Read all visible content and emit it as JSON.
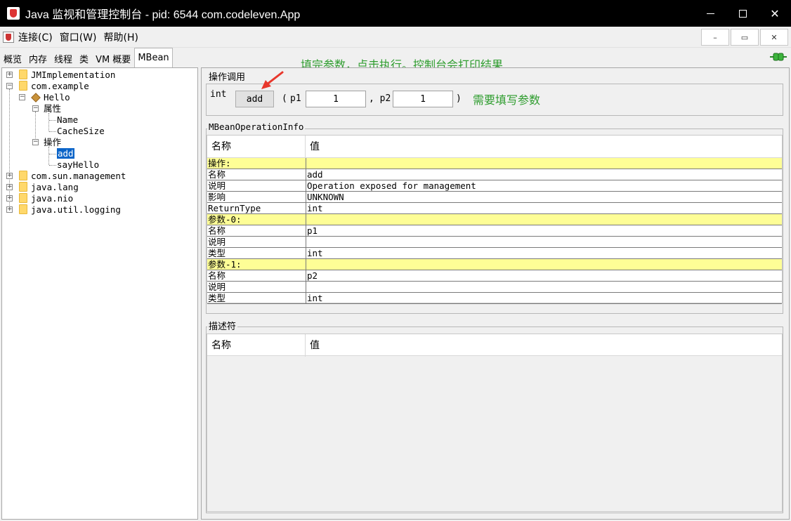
{
  "window": {
    "title": "Java 监视和管理控制台 - pid: 6544 com.codeleven.App",
    "min_label": "",
    "close_label": "✕"
  },
  "menubar": {
    "items": [
      "连接(C)",
      "窗口(W)",
      "帮助(H)"
    ],
    "mdi_min": "–",
    "mdi_restore": "▭",
    "mdi_close": "✕"
  },
  "tabs": [
    "概览",
    "内存",
    "线程",
    "类",
    "VM 概要",
    "MBean"
  ],
  "active_tab": "MBean",
  "annotations": {
    "top": "填完参数，点击执行。控制台会打印结果",
    "right": "需要填写参数"
  },
  "tree": {
    "nodes": [
      "JMImplementation",
      "com.example",
      "Hello",
      "属性",
      "Name",
      "CacheSize",
      "操作",
      "add",
      "sayHello",
      "com.sun.management",
      "java.lang",
      "java.nio",
      "java.util.logging"
    ],
    "selected": "add"
  },
  "operation": {
    "group_title": "操作调用",
    "return_type": "int",
    "button_label": "add",
    "open_paren": "(",
    "p1_label": "p1",
    "p1_value": "1",
    "comma_p2": ", p2",
    "p2_value": "1",
    "close_paren": ")"
  },
  "info": {
    "group_title": "MBeanOperationInfo",
    "headers": [
      "名称",
      "值"
    ],
    "rows": [
      {
        "name": "操作:",
        "value": "",
        "highlight": true
      },
      {
        "name": "名称",
        "value": "add",
        "highlight": false
      },
      {
        "name": "说明",
        "value": "Operation exposed for management",
        "highlight": false
      },
      {
        "name": "影响",
        "value": "UNKNOWN",
        "highlight": false
      },
      {
        "name": "ReturnType",
        "value": "int",
        "highlight": false
      },
      {
        "name": "参数-0:",
        "value": "",
        "highlight": true
      },
      {
        "name": "名称",
        "value": "p1",
        "highlight": false
      },
      {
        "name": "说明",
        "value": "",
        "highlight": false
      },
      {
        "name": "类型",
        "value": "int",
        "highlight": false
      },
      {
        "name": "参数-1:",
        "value": "",
        "highlight": true
      },
      {
        "name": "名称",
        "value": "p2",
        "highlight": false
      },
      {
        "name": "说明",
        "value": "",
        "highlight": false
      },
      {
        "name": "类型",
        "value": "int",
        "highlight": false
      }
    ]
  },
  "descriptor": {
    "group_title": "描述符",
    "headers": [
      "名称",
      "值"
    ]
  },
  "colors": {
    "annotation_green": "#2f9d2f",
    "highlight_yellow": "#fefe96",
    "selection_blue": "#0a64c8",
    "arrow_red": "#e8372c"
  }
}
